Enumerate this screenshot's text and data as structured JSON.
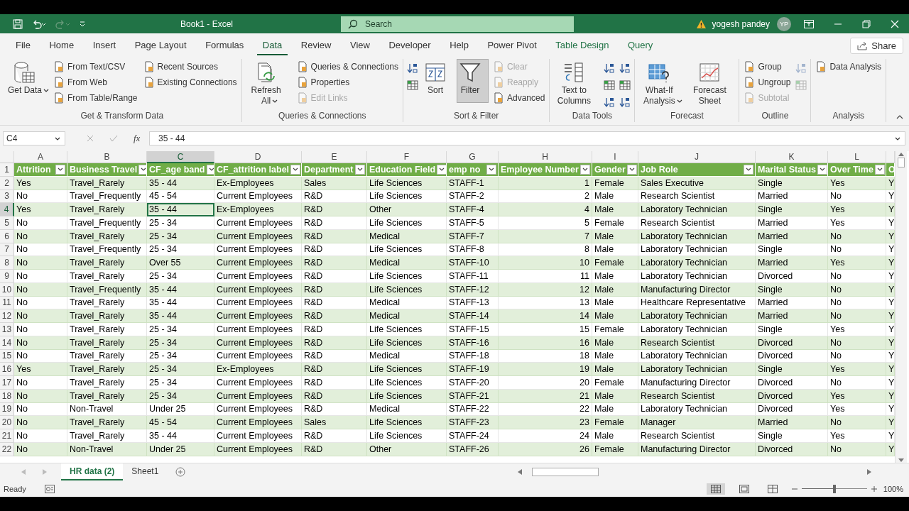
{
  "title_bar": {
    "title": "Book1 - Excel",
    "search": {
      "placeholder": "Search"
    },
    "user": "yogesh pandey",
    "avatar": "YP"
  },
  "menu_tabs": [
    {
      "label": "File",
      "selected": false,
      "kind": "normal"
    },
    {
      "label": "Home",
      "selected": false,
      "kind": "normal"
    },
    {
      "label": "Insert",
      "selected": false,
      "kind": "normal"
    },
    {
      "label": "Page Layout",
      "selected": false,
      "kind": "normal"
    },
    {
      "label": "Formulas",
      "selected": false,
      "kind": "normal"
    },
    {
      "label": "Data",
      "selected": true,
      "kind": "normal"
    },
    {
      "label": "Review",
      "selected": false,
      "kind": "normal"
    },
    {
      "label": "View",
      "selected": false,
      "kind": "normal"
    },
    {
      "label": "Developer",
      "selected": false,
      "kind": "normal"
    },
    {
      "label": "Help",
      "selected": false,
      "kind": "normal"
    },
    {
      "label": "Power Pivot",
      "selected": false,
      "kind": "normal"
    },
    {
      "label": "Table Design",
      "selected": false,
      "kind": "contextual"
    },
    {
      "label": "Query",
      "selected": false,
      "kind": "contextual"
    }
  ],
  "share_button": "Share",
  "ribbon_groups": [
    {
      "name": "Get & Transform Data",
      "columns": [
        {
          "kind": "large",
          "label": "Get Data",
          "dropdown": true,
          "selected": false
        },
        {
          "kind": "stack",
          "items": [
            {
              "label": "From Text/CSV",
              "disabled": false
            },
            {
              "label": "From Web",
              "disabled": false
            },
            {
              "label": "From Table/Range",
              "disabled": false
            }
          ]
        },
        {
          "kind": "stack",
          "items": [
            {
              "label": "Recent Sources",
              "disabled": false
            },
            {
              "label": "Existing Connections",
              "disabled": false
            }
          ]
        }
      ]
    },
    {
      "name": "Queries & Connections",
      "columns": [
        {
          "kind": "large",
          "label": "Refresh All",
          "dropdown": true,
          "selected": false
        },
        {
          "kind": "stack",
          "items": [
            {
              "label": "Queries & Connections",
              "disabled": false
            },
            {
              "label": "Properties",
              "disabled": false
            },
            {
              "label": "Edit Links",
              "disabled": true
            }
          ]
        }
      ]
    },
    {
      "name": "Sort & Filter",
      "columns": [
        {
          "kind": "icons",
          "items": [
            {
              "disabled": false
            },
            {
              "disabled": false
            }
          ]
        },
        {
          "kind": "large",
          "label": "Sort",
          "dropdown": false,
          "selected": false
        },
        {
          "kind": "large",
          "label": "Filter",
          "dropdown": false,
          "selected": true
        },
        {
          "kind": "stack",
          "items": [
            {
              "label": "Clear",
              "disabled": true
            },
            {
              "label": "Reapply",
              "disabled": true
            },
            {
              "label": "Advanced",
              "disabled": false
            }
          ]
        }
      ]
    },
    {
      "name": "Data Tools",
      "columns": [
        {
          "kind": "large",
          "label": "Text to Columns",
          "dropdown": false,
          "selected": false
        },
        {
          "kind": "icons",
          "items": [
            {
              "disabled": false
            },
            {
              "disabled": false
            },
            {
              "disabled": false
            }
          ]
        },
        {
          "kind": "icons",
          "items": [
            {
              "disabled": false
            },
            {
              "disabled": false
            },
            {
              "disabled": false
            }
          ]
        }
      ]
    },
    {
      "name": "Forecast",
      "columns": [
        {
          "kind": "large",
          "label": "What-If Analysis",
          "dropdown": true,
          "selected": false
        },
        {
          "kind": "large",
          "label": "Forecast Sheet",
          "dropdown": false,
          "selected": false
        }
      ]
    },
    {
      "name": "Outline",
      "columns": [
        {
          "kind": "stack",
          "items": [
            {
              "label": "Group",
              "disabled": false
            },
            {
              "label": "Ungroup",
              "disabled": false
            },
            {
              "label": "Subtotal",
              "disabled": true
            }
          ]
        },
        {
          "kind": "icons",
          "items": [
            {
              "disabled": true
            },
            {
              "disabled": true
            }
          ]
        }
      ]
    },
    {
      "name": "Analysis",
      "columns": [
        {
          "kind": "stack",
          "items": [
            {
              "label": "Data Analysis",
              "disabled": false
            }
          ]
        }
      ]
    }
  ],
  "formula_bar": {
    "name_box": "C4",
    "fx": "fx",
    "value": "35 - 44"
  },
  "sheet": {
    "columns": [
      {
        "letter": "A",
        "kind": "text",
        "selected": false
      },
      {
        "letter": "B",
        "kind": "text",
        "selected": false
      },
      {
        "letter": "C",
        "kind": "text",
        "selected": true
      },
      {
        "letter": "D",
        "kind": "text",
        "selected": false
      },
      {
        "letter": "E",
        "kind": "text",
        "selected": false
      },
      {
        "letter": "F",
        "kind": "text",
        "selected": false
      },
      {
        "letter": "G",
        "kind": "text",
        "selected": false
      },
      {
        "letter": "H",
        "kind": "number",
        "selected": false
      },
      {
        "letter": "I",
        "kind": "text",
        "selected": false
      },
      {
        "letter": "J",
        "kind": "text",
        "selected": false
      },
      {
        "letter": "K",
        "kind": "text",
        "selected": false
      },
      {
        "letter": "L",
        "kind": "text",
        "selected": false
      },
      {
        "kind": "text",
        "selected": false
      }
    ],
    "header_row": {
      "row_number": "1",
      "cells": [
        "Attrition",
        "Business Travel",
        "CF_age band",
        "CF_attrition label",
        "Department",
        "Education Field",
        "emp no",
        "Employee Number",
        "Gender",
        "Job Role",
        "Marital Status",
        "Over Time",
        "O"
      ]
    },
    "rows": [
      {
        "row_number": "2",
        "selected": false,
        "cells": [
          "Yes",
          "Travel_Rarely",
          "35 - 44",
          "Ex-Employees",
          "Sales",
          "Life Sciences",
          "STAFF-1",
          "1",
          "Female",
          "Sales Executive",
          "Single",
          "Yes",
          "Y"
        ]
      },
      {
        "row_number": "3",
        "selected": false,
        "cells": [
          "No",
          "Travel_Frequently",
          "45 - 54",
          "Current Employees",
          "R&D",
          "Life Sciences",
          "STAFF-2",
          "2",
          "Male",
          "Research Scientist",
          "Married",
          "No",
          "Y"
        ]
      },
      {
        "row_number": "4",
        "selected": true,
        "cells": [
          "Yes",
          "Travel_Rarely",
          "35 - 44",
          "Ex-Employees",
          "R&D",
          "Other",
          "STAFF-4",
          "4",
          "Male",
          "Laboratory Technician",
          "Single",
          "Yes",
          "Y"
        ]
      },
      {
        "row_number": "5",
        "selected": false,
        "cells": [
          "No",
          "Travel_Frequently",
          "25 - 34",
          "Current Employees",
          "R&D",
          "Life Sciences",
          "STAFF-5",
          "5",
          "Female",
          "Research Scientist",
          "Married",
          "Yes",
          "Y"
        ]
      },
      {
        "row_number": "6",
        "selected": false,
        "cells": [
          "No",
          "Travel_Rarely",
          "25 - 34",
          "Current Employees",
          "R&D",
          "Medical",
          "STAFF-7",
          "7",
          "Male",
          "Laboratory Technician",
          "Married",
          "No",
          "Y"
        ]
      },
      {
        "row_number": "7",
        "selected": false,
        "cells": [
          "No",
          "Travel_Frequently",
          "25 - 34",
          "Current Employees",
          "R&D",
          "Life Sciences",
          "STAFF-8",
          "8",
          "Male",
          "Laboratory Technician",
          "Single",
          "No",
          "Y"
        ]
      },
      {
        "row_number": "8",
        "selected": false,
        "cells": [
          "No",
          "Travel_Rarely",
          "Over 55",
          "Current Employees",
          "R&D",
          "Medical",
          "STAFF-10",
          "10",
          "Female",
          "Laboratory Technician",
          "Married",
          "Yes",
          "Y"
        ]
      },
      {
        "row_number": "9",
        "selected": false,
        "cells": [
          "No",
          "Travel_Rarely",
          "25 - 34",
          "Current Employees",
          "R&D",
          "Life Sciences",
          "STAFF-11",
          "11",
          "Male",
          "Laboratory Technician",
          "Divorced",
          "No",
          "Y"
        ]
      },
      {
        "row_number": "10",
        "selected": false,
        "cells": [
          "No",
          "Travel_Frequently",
          "35 - 44",
          "Current Employees",
          "R&D",
          "Life Sciences",
          "STAFF-12",
          "12",
          "Male",
          "Manufacturing Director",
          "Single",
          "No",
          "Y"
        ]
      },
      {
        "row_number": "11",
        "selected": false,
        "cells": [
          "No",
          "Travel_Rarely",
          "35 - 44",
          "Current Employees",
          "R&D",
          "Medical",
          "STAFF-13",
          "13",
          "Male",
          "Healthcare Representative",
          "Married",
          "No",
          "Y"
        ]
      },
      {
        "row_number": "12",
        "selected": false,
        "cells": [
          "No",
          "Travel_Rarely",
          "35 - 44",
          "Current Employees",
          "R&D",
          "Medical",
          "STAFF-14",
          "14",
          "Male",
          "Laboratory Technician",
          "Married",
          "No",
          "Y"
        ]
      },
      {
        "row_number": "13",
        "selected": false,
        "cells": [
          "No",
          "Travel_Rarely",
          "25 - 34",
          "Current Employees",
          "R&D",
          "Life Sciences",
          "STAFF-15",
          "15",
          "Female",
          "Laboratory Technician",
          "Single",
          "Yes",
          "Y"
        ]
      },
      {
        "row_number": "14",
        "selected": false,
        "cells": [
          "No",
          "Travel_Rarely",
          "25 - 34",
          "Current Employees",
          "R&D",
          "Life Sciences",
          "STAFF-16",
          "16",
          "Male",
          "Research Scientist",
          "Divorced",
          "No",
          "Y"
        ]
      },
      {
        "row_number": "15",
        "selected": false,
        "cells": [
          "No",
          "Travel_Rarely",
          "25 - 34",
          "Current Employees",
          "R&D",
          "Medical",
          "STAFF-18",
          "18",
          "Male",
          "Laboratory Technician",
          "Divorced",
          "No",
          "Y"
        ]
      },
      {
        "row_number": "16",
        "selected": false,
        "cells": [
          "Yes",
          "Travel_Rarely",
          "25 - 34",
          "Ex-Employees",
          "R&D",
          "Life Sciences",
          "STAFF-19",
          "19",
          "Male",
          "Laboratory Technician",
          "Single",
          "Yes",
          "Y"
        ]
      },
      {
        "row_number": "17",
        "selected": false,
        "cells": [
          "No",
          "Travel_Rarely",
          "25 - 34",
          "Current Employees",
          "R&D",
          "Life Sciences",
          "STAFF-20",
          "20",
          "Female",
          "Manufacturing Director",
          "Divorced",
          "No",
          "Y"
        ]
      },
      {
        "row_number": "18",
        "selected": false,
        "cells": [
          "No",
          "Travel_Rarely",
          "25 - 34",
          "Current Employees",
          "R&D",
          "Life Sciences",
          "STAFF-21",
          "21",
          "Male",
          "Research Scientist",
          "Divorced",
          "Yes",
          "Y"
        ]
      },
      {
        "row_number": "19",
        "selected": false,
        "cells": [
          "No",
          "Non-Travel",
          "Under 25",
          "Current Employees",
          "R&D",
          "Medical",
          "STAFF-22",
          "22",
          "Male",
          "Laboratory Technician",
          "Divorced",
          "Yes",
          "Y"
        ]
      },
      {
        "row_number": "20",
        "selected": false,
        "cells": [
          "No",
          "Travel_Rarely",
          "45 - 54",
          "Current Employees",
          "Sales",
          "Life Sciences",
          "STAFF-23",
          "23",
          "Female",
          "Manager",
          "Married",
          "No",
          "Y"
        ]
      },
      {
        "row_number": "21",
        "selected": false,
        "cells": [
          "No",
          "Travel_Rarely",
          "35 - 44",
          "Current Employees",
          "R&D",
          "Life Sciences",
          "STAFF-24",
          "24",
          "Male",
          "Research Scientist",
          "Single",
          "Yes",
          "Y"
        ]
      },
      {
        "row_number": "22",
        "selected": false,
        "cells": [
          "No",
          "Non-Travel",
          "Under 25",
          "Current Employees",
          "R&D",
          "Other",
          "STAFF-26",
          "26",
          "Female",
          "Manufacturing Director",
          "Divorced",
          "No",
          "Y"
        ]
      }
    ]
  },
  "sheet_tabs": [
    {
      "label": "HR data (2)",
      "selected": true
    },
    {
      "label": "Sheet1",
      "selected": false
    }
  ],
  "status_bar": {
    "status": "Ready",
    "views": [
      {
        "selected": true
      },
      {
        "selected": false
      },
      {
        "selected": false
      }
    ],
    "zoom": {
      "level": 0.5,
      "reading": "100%"
    }
  }
}
